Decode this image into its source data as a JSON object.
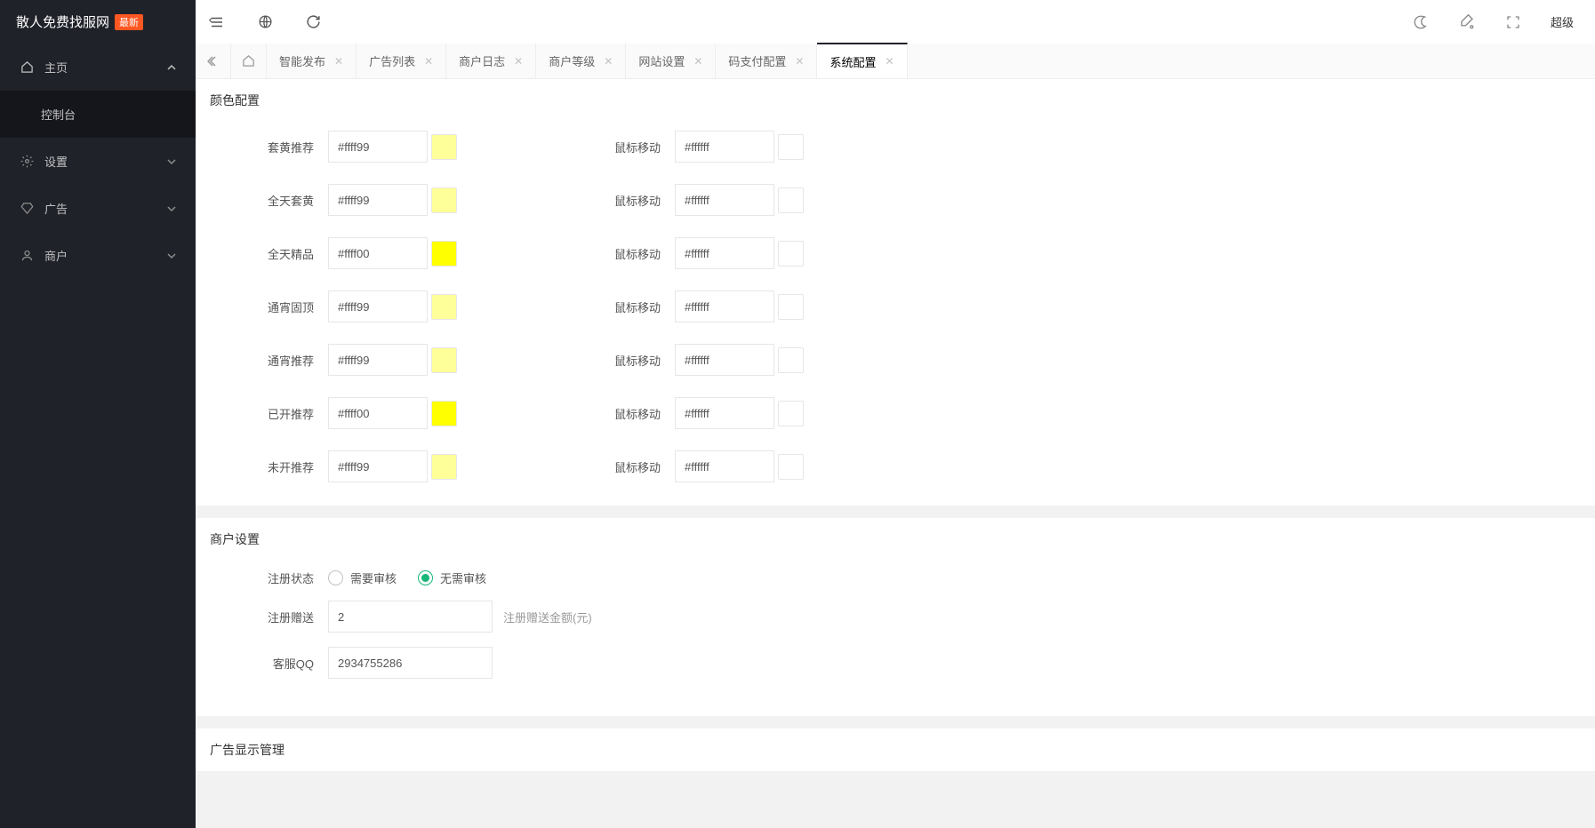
{
  "brand": {
    "title": "散人免费找服网",
    "badge": "最新"
  },
  "sidebar": {
    "items": [
      {
        "label": "主页",
        "icon": "home"
      },
      {
        "label": "控制台",
        "icon": ""
      },
      {
        "label": "设置",
        "icon": "gear"
      },
      {
        "label": "广告",
        "icon": "diamond"
      },
      {
        "label": "商户",
        "icon": "user"
      }
    ]
  },
  "topbar": {
    "user": "超级"
  },
  "tabs": [
    {
      "label": "智能发布"
    },
    {
      "label": "广告列表"
    },
    {
      "label": "商户日志"
    },
    {
      "label": "商户等级"
    },
    {
      "label": "网站设置"
    },
    {
      "label": "码支付配置"
    },
    {
      "label": "系统配置"
    }
  ],
  "color_section": {
    "title": "颜色配置"
  },
  "colors": [
    {
      "left_label": "套黄推荐",
      "left_value": "#ffff99",
      "left_swatch": "#ffff99",
      "right_label": "鼠标移动",
      "right_value": "#ffffff",
      "right_swatch": "#ffffff"
    },
    {
      "left_label": "全天套黄",
      "left_value": "#ffff99",
      "left_swatch": "#ffff99",
      "right_label": "鼠标移动",
      "right_value": "#ffffff",
      "right_swatch": "#ffffff"
    },
    {
      "left_label": "全天精品",
      "left_value": "#ffff00",
      "left_swatch": "#ffff00",
      "right_label": "鼠标移动",
      "right_value": "#ffffff",
      "right_swatch": "#ffffff"
    },
    {
      "left_label": "通宵固顶",
      "left_value": "#ffff99",
      "left_swatch": "#ffff99",
      "right_label": "鼠标移动",
      "right_value": "#ffffff",
      "right_swatch": "#ffffff"
    },
    {
      "left_label": "通宵推荐",
      "left_value": "#ffff99",
      "left_swatch": "#ffff99",
      "right_label": "鼠标移动",
      "right_value": "#ffffff",
      "right_swatch": "#ffffff"
    },
    {
      "left_label": "已开推荐",
      "left_value": "#ffff00",
      "left_swatch": "#ffff00",
      "right_label": "鼠标移动",
      "right_value": "#ffffff",
      "right_swatch": "#ffffff"
    },
    {
      "left_label": "未开推荐",
      "left_value": "#ffff99",
      "left_swatch": "#ffff99",
      "right_label": "鼠标移动",
      "right_value": "#ffffff",
      "right_swatch": "#ffffff"
    }
  ],
  "merchant_section": {
    "title": "商户设置",
    "reg_status_label": "注册状态",
    "radio1": "需要审核",
    "radio2": "无需审核",
    "reg_gift_label": "注册赠送",
    "reg_gift_value": "2",
    "reg_gift_help": "注册赠送金额(元)",
    "qq_label": "客服QQ",
    "qq_value": "2934755286"
  },
  "ad_section": {
    "title": "广告显示管理"
  }
}
